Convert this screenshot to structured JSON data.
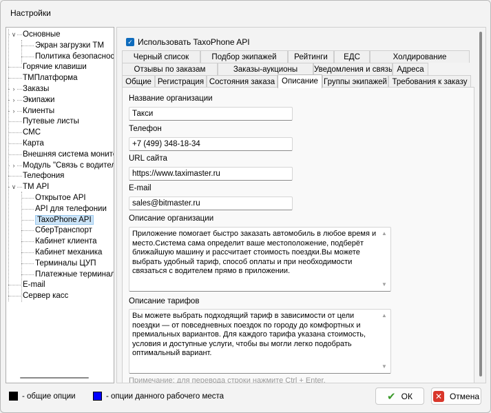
{
  "window": {
    "title": "Настройки"
  },
  "tree": {
    "items": [
      {
        "label": "Основные",
        "expander": "expanded"
      },
      {
        "label": "Экран загрузки ТМ"
      },
      {
        "label": "Политика безопасност"
      },
      {
        "label": "Горячие клавиши"
      },
      {
        "label": "ТМПлатформа"
      },
      {
        "label": "Заказы",
        "expander": "collapsed"
      },
      {
        "label": "Экипажи",
        "expander": "collapsed"
      },
      {
        "label": "Клиенты",
        "expander": "collapsed"
      },
      {
        "label": "Путевые листы"
      },
      {
        "label": "СМС"
      },
      {
        "label": "Карта"
      },
      {
        "label": "Внешняя система монитори"
      },
      {
        "label": "Модуль \"Связь с водителя",
        "expander": "collapsed"
      },
      {
        "label": "Телефония"
      },
      {
        "label": "ТМ API",
        "expander": "expanded"
      },
      {
        "label": "Открытое API"
      },
      {
        "label": "API для телефонии"
      },
      {
        "label": "TaxoPhone API",
        "selected": true
      },
      {
        "label": "СберТранспорт"
      },
      {
        "label": "Кабинет клиента"
      },
      {
        "label": "Кабинет механика"
      },
      {
        "label": "Терминалы ЦУП"
      },
      {
        "label": "Платежные терминал"
      },
      {
        "label": "E-mail"
      },
      {
        "label": "Сервер касс"
      }
    ]
  },
  "use_api": {
    "label": "Использовать TaxoPhone API",
    "checked": true
  },
  "tabs": {
    "row1": [
      "Черный список",
      "Подбор экипажей",
      "Рейтинги",
      "ЕДС",
      "Холдирование"
    ],
    "row2": [
      "Отзывы по заказам",
      "Заказы-аукционы",
      "Уведомления и связь",
      "Адреса"
    ],
    "row3": [
      "Общие",
      "Регистрация",
      "Состояния заказа",
      "Описание",
      "Группы экипажей",
      "Требования к заказу"
    ],
    "active": "Описание"
  },
  "form": {
    "org_name": {
      "label": "Название организации",
      "value": "Такси"
    },
    "phone": {
      "label": "Телефон",
      "value": "+7 (499) 348-18-34"
    },
    "url": {
      "label": "URL сайта",
      "value": "https://www.taximaster.ru"
    },
    "email": {
      "label": "E-mail",
      "value": "sales@bitmaster.ru"
    },
    "org_desc": {
      "label": "Описание организации",
      "value": "Приложение помогает быстро заказать автомобиль в любое время и место.Система сама определит ваше местоположение, подберёт ближайшую машину и рассчитает стоимость поездки.Вы можете выбрать удобный тариф, способ оплаты и при необходимости связаться с водителем прямо в приложении."
    },
    "tariff_desc": {
      "label": "Описание тарифов",
      "value": "Вы можете выбрать подходящий тариф в зависимости от цели поездки — от повседневных поездок по городу до комфортных и премиальных вариантов. Для каждого тарифа указана стоимость, условия и доступные услуги, чтобы вы могли легко подобрать оптимальный вариант."
    },
    "note": "Примечание: для перевода строки нажмите Ctrl + Enter."
  },
  "legend": {
    "common": {
      "label": "- общие опции",
      "color": "#000000"
    },
    "workplace": {
      "label": "- опции данного рабочего места",
      "color": "#0000ff"
    }
  },
  "buttons": {
    "ok": "ОК",
    "cancel": "Отмена"
  },
  "colors": {
    "accent": "#0f6cbd",
    "selection": "#cce4f7"
  }
}
